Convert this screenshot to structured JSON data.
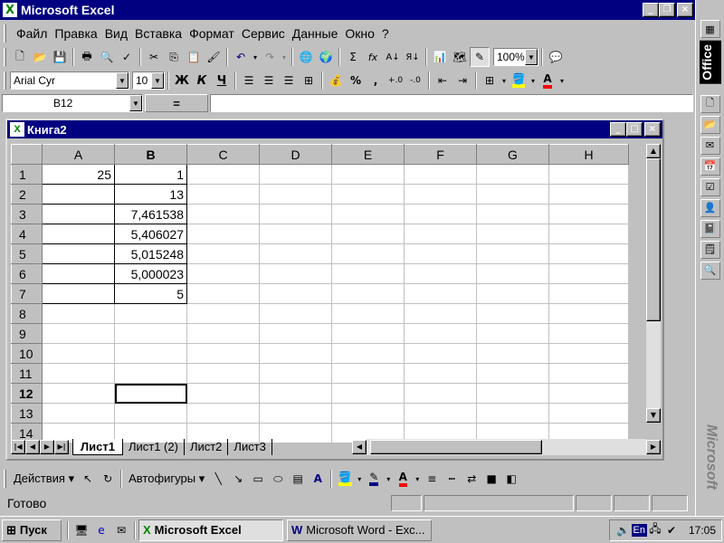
{
  "app": {
    "title": "Microsoft Excel",
    "icon_glyph": "X"
  },
  "menu": [
    "Файл",
    "Правка",
    "Вид",
    "Вставка",
    "Формат",
    "Сервис",
    "Данные",
    "Окно",
    "?"
  ],
  "standard_toolbar": {
    "zoom": "100%"
  },
  "formatting_toolbar": {
    "font": "Arial Cyr",
    "size": "10",
    "bold": "Ж",
    "italic": "К",
    "underline": "Ч",
    "percent": "%",
    "comma": ","
  },
  "formula_bar": {
    "name_box": "B12",
    "equals": "=",
    "content": ""
  },
  "workbook": {
    "title": "Книга2"
  },
  "grid": {
    "columns": [
      "A",
      "B",
      "C",
      "D",
      "E",
      "F",
      "G",
      "H"
    ],
    "rows": [
      {
        "n": "1",
        "A": "25",
        "B": "1"
      },
      {
        "n": "2",
        "A": "",
        "B": "13"
      },
      {
        "n": "3",
        "A": "",
        "B": "7,461538"
      },
      {
        "n": "4",
        "A": "",
        "B": "5,406027"
      },
      {
        "n": "5",
        "A": "",
        "B": "5,015248"
      },
      {
        "n": "6",
        "A": "",
        "B": "5,000023"
      },
      {
        "n": "7",
        "A": "",
        "B": "5"
      },
      {
        "n": "8",
        "A": "",
        "B": ""
      },
      {
        "n": "9",
        "A": "",
        "B": ""
      },
      {
        "n": "10",
        "A": "",
        "B": ""
      },
      {
        "n": "11",
        "A": "",
        "B": ""
      },
      {
        "n": "12",
        "A": "",
        "B": ""
      },
      {
        "n": "13",
        "A": "",
        "B": ""
      },
      {
        "n": "14",
        "A": "",
        "B": ""
      }
    ],
    "active_cell": "B12"
  },
  "sheet_tabs": [
    "Лист1",
    "Лист1 (2)",
    "Лист2",
    "Лист3"
  ],
  "drawing_toolbar": {
    "actions": "Действия",
    "autoshapes": "Автофигуры"
  },
  "status": {
    "text": "Готово"
  },
  "office_bar": {
    "label": "Office",
    "brand": "Microsoft"
  },
  "taskbar": {
    "start": "Пуск",
    "tasks": [
      "Microsoft Excel",
      "Microsoft Word - Exc..."
    ],
    "lang": "En",
    "clock": "17:05"
  },
  "colors": {
    "titlebar": "#000080",
    "face": "#c0c0c0",
    "fill_color": "#ffff00",
    "font_color": "#ff0000"
  }
}
